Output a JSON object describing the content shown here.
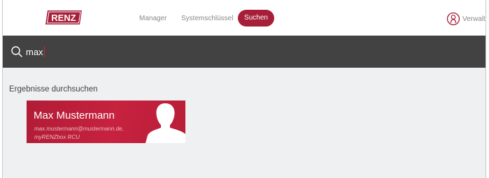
{
  "header": {
    "logo_text": "RENZ",
    "nav": {
      "manager": "Manager",
      "system_keys": "Systemschlüssel",
      "search": "Suchen"
    },
    "user_label": "Verwalter"
  },
  "search": {
    "value": "max",
    "icon": "search-icon"
  },
  "results": {
    "heading": "Ergebnisse durchsuchen",
    "items": [
      {
        "name": "Max Mustermann",
        "email": "max.mustermann@mustermann.de,",
        "device": "myRENZbox RCU"
      }
    ]
  },
  "colors": {
    "brand_red": "#a61e38",
    "searchbar_bg": "#424242",
    "content_bg": "#eef0f1"
  }
}
